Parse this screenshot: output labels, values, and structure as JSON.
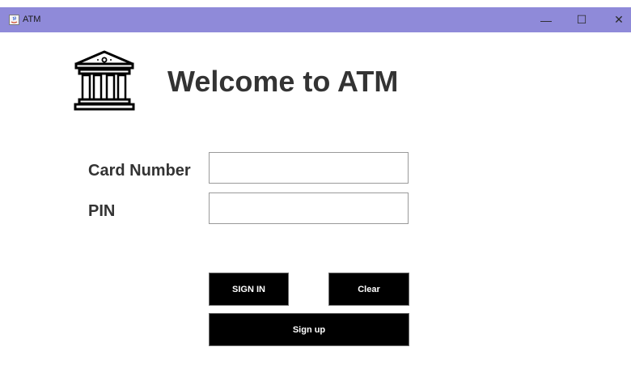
{
  "window": {
    "title": "ATM",
    "controls": {
      "minimize": "—",
      "maximize": "☐",
      "close": "✕"
    }
  },
  "header": {
    "icon": "bank-building-icon",
    "title": "Welcome to ATM"
  },
  "form": {
    "card_label": "Card Number",
    "card_value": "",
    "pin_label": "PIN",
    "pin_value": ""
  },
  "buttons": {
    "signin": "SIGN IN",
    "clear": "Clear",
    "signup": "Sign up"
  },
  "colors": {
    "titlebar": "#8f8ad9",
    "button_bg": "#000000",
    "button_text": "#ffffff",
    "heading": "#333333"
  }
}
